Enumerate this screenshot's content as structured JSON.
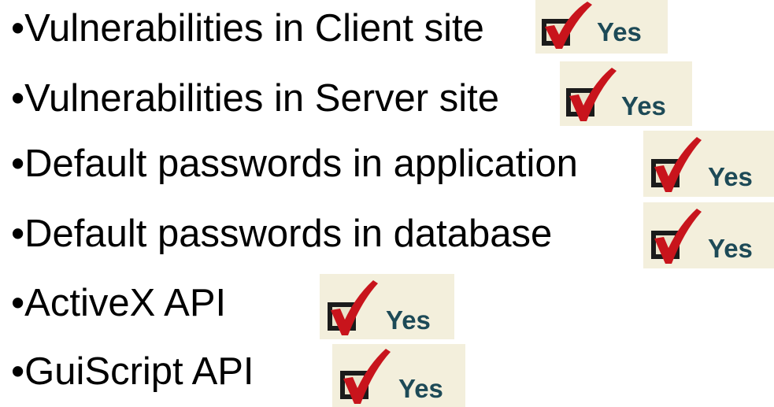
{
  "items": [
    {
      "bullet": "•",
      "label": "Vulnerabilities in Client site",
      "status": "Yes"
    },
    {
      "bullet": "•",
      "label": "Vulnerabilities in Server site",
      "status": "Yes"
    },
    {
      "bullet": "•",
      "label": "Default passwords in application",
      "status": "Yes"
    },
    {
      "bullet": "•",
      "label": "Default passwords in database",
      "status": "Yes"
    },
    {
      "bullet": "•",
      "label": "ActiveX API",
      "status": "Yes"
    },
    {
      "bullet": "•",
      "label": "GuiScript API",
      "status": "Yes"
    }
  ],
  "icons": {
    "check": "checkmark-icon",
    "box": "checkbox-icon"
  },
  "colors": {
    "text": "#000000",
    "badge_bg": "#f3efdc",
    "check_red": "#c8141c",
    "box_dark": "#1b1b1b",
    "yes_text": "#1d4a57"
  }
}
